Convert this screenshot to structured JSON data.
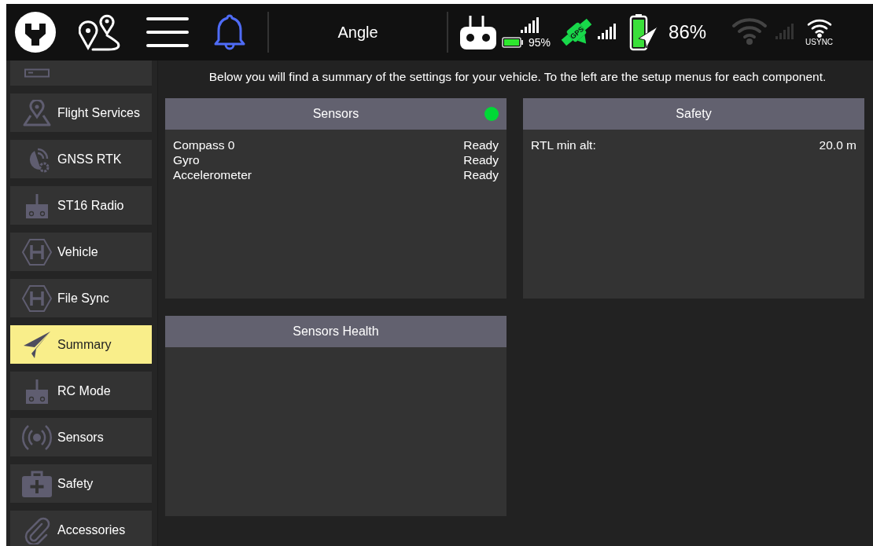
{
  "toolbar": {
    "flight_mode": "Angle",
    "remote_battery": "95%",
    "gps_label": "GPS",
    "vehicle_battery": "86%",
    "wifi_name": "USYNC"
  },
  "sidebar": {
    "items": [
      {
        "selected": false
      },
      {
        "label": "Flight Services",
        "selected": false
      },
      {
        "label": "GNSS RTK",
        "selected": false
      },
      {
        "label": "ST16 Radio",
        "selected": false
      },
      {
        "label": "Vehicle",
        "selected": false
      },
      {
        "label": "File Sync",
        "selected": false
      },
      {
        "label": "Summary",
        "selected": true
      },
      {
        "label": "RC Mode",
        "selected": false
      },
      {
        "label": "Sensors",
        "selected": false
      },
      {
        "label": "Safety",
        "selected": false
      },
      {
        "label": "Accessories",
        "selected": false
      }
    ]
  },
  "intro": "Below you will find a summary of the settings for your vehicle. To the left are the setup menus for each component.",
  "panels": [
    {
      "title": "Sensors",
      "color": "#00d936",
      "rows": [
        {
          "label": "Compass 0",
          "value": "Ready"
        },
        {
          "label": "Gyro",
          "value": "Ready"
        },
        {
          "label": "Accelerometer",
          "value": "Ready"
        }
      ]
    },
    {
      "title": "Safety",
      "rows": [
        {
          "label": "RTL min alt:",
          "value": "20.0 m"
        }
      ]
    },
    {
      "title": "Sensors Health"
    }
  ]
}
